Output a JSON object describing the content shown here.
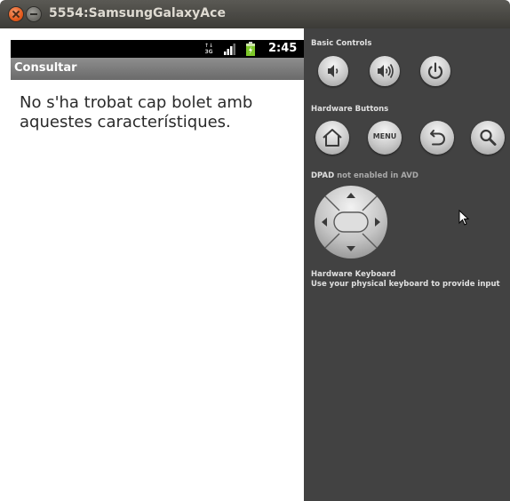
{
  "window": {
    "title": "5554:SamsungGalaxyAce"
  },
  "status_bar": {
    "data_indicator_top": "↑↓",
    "data_indicator_bottom": "3G",
    "time": "2:45"
  },
  "app": {
    "title": "Consultar",
    "message": "No s'ha trobat cap bolet amb aquestes característiques."
  },
  "controls": {
    "basic_controls_label": "Basic Controls",
    "basic_buttons": [
      {
        "icon": "volume-down-icon"
      },
      {
        "icon": "volume-up-icon"
      },
      {
        "icon": "power-icon"
      }
    ],
    "hardware_buttons_label": "Hardware Buttons",
    "hardware_buttons": [
      {
        "icon": "home-icon"
      },
      {
        "icon": "menu-icon",
        "label": "MENU"
      },
      {
        "icon": "back-icon"
      },
      {
        "icon": "search-icon"
      }
    ],
    "dpad_label_bold": "DPAD",
    "dpad_label_rest": " not enabled in AVD",
    "keyboard_label": "Hardware Keyboard",
    "keyboard_hint": "Use your physical keyboard to provide input"
  },
  "colors": {
    "titlebar": "#3c3b37",
    "close_button": "#e45a1c",
    "panel": "#424242",
    "appbar": "#7a7a7a",
    "statusbar": "#000000",
    "battery": "#7ec82a"
  }
}
